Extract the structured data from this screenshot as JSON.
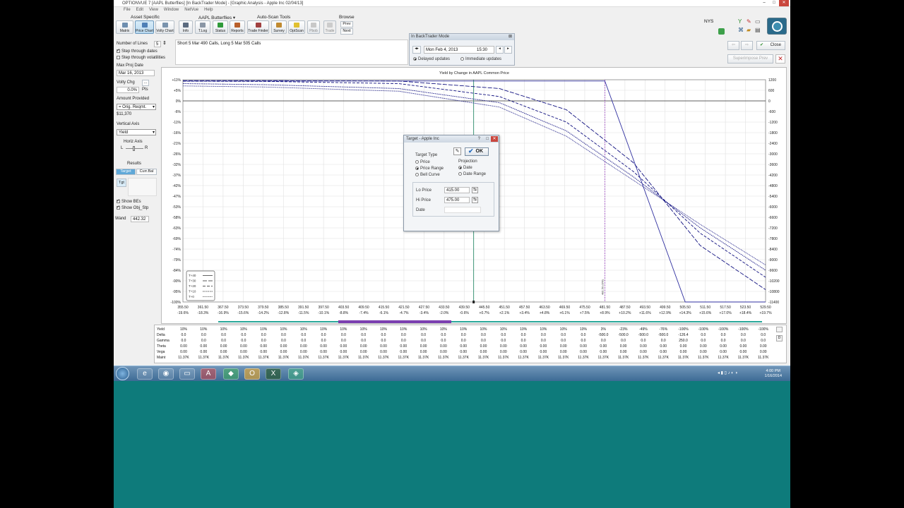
{
  "window": {
    "title": "OPTIONVUE 7   [AAPL Butterflies]   [In BackTrader Mode]  - [Graphic Analysis - Apple Inc  02/04/13]",
    "menu": [
      "File",
      "Edit",
      "View",
      "Window",
      "NetVue",
      "Help"
    ]
  },
  "toolbar": {
    "group_asset": "Asset Specific",
    "group_portfolio": "AAPL Butterflies ▾",
    "group_autoscan": "Auto-Scan Tools",
    "group_browse": "Browse",
    "buttons": [
      "Matrix",
      "Price Chart",
      "Volty Chart",
      "Info",
      "T.Log",
      "Status",
      "Reports",
      "Trade Finder",
      "Survey",
      "OptScan",
      "Pbob",
      "Trade"
    ],
    "prev": "Prev",
    "next": "Next",
    "nys": "NYS"
  },
  "left": {
    "num_lines_label": "Number of Lines",
    "num_lines_value": "5",
    "step_dates": "Step through dates",
    "step_vols": "Step through volatilities",
    "max_proj_label": "Max Proj Date",
    "max_proj_value": "Mar 16, 2013",
    "volty_label": "Volty Chg",
    "volty_value": "0.0%",
    "volty_unit": "Pts",
    "amount_label": "Amount Provided",
    "amount_select": "= Orig. Reqmt.",
    "amount_value": "$11,370",
    "vaxis_label": "Vertical Axis",
    "vaxis_value": "Yield",
    "haxis_label": "Horiz Axis",
    "haxis_l": "L",
    "haxis_r": "R",
    "results_label": "Results",
    "target_btn": "Target",
    "currbal_btn": "Curr.Bal",
    "tgt_btn": "Tgt",
    "show_bes": "Show BEs",
    "show_objstp": "Show Obj_Stp",
    "wand_label": "Wand",
    "wand_value": "442.32"
  },
  "strategy": "Short 5 Mar 490 Calls, Long 5 Mar 505 Calls",
  "backtrader": {
    "title": "In BackTrader Mode",
    "date": "Mon Feb 4, 2013",
    "time": "15:30",
    "delayed": "Delayed updates",
    "immediate": "Immediate updates"
  },
  "right": {
    "close": "Close",
    "superimpose": "Superimpose Prev"
  },
  "chart_data": {
    "type": "line",
    "title": "Yield by Change in AAPL Common Price",
    "x_ticks": [
      "355.50",
      "361.50",
      "367.50",
      "373.50",
      "379.50",
      "385.50",
      "391.50",
      "397.50",
      "403.50",
      "409.50",
      "415.50",
      "421.50",
      "427.50",
      "433.50",
      "439.50",
      "445.50",
      "451.50",
      "457.50",
      "463.50",
      "469.50",
      "475.50",
      "481.50",
      "487.50",
      "493.50",
      "499.50",
      "505.50",
      "511.50",
      "517.50",
      "523.50",
      "529.50"
    ],
    "x_pct": [
      "-19.6%",
      "-18.3%",
      "-16.9%",
      "-15.6%",
      "-14.2%",
      "-12.8%",
      "-11.5%",
      "-10.1%",
      "-8.8%",
      "-7.4%",
      "-6.1%",
      "-4.7%",
      "-3.4%",
      "-2.0%",
      "-0.6%",
      "+0.7%",
      "+2.1%",
      "+3.4%",
      "+4.8%",
      "+6.1%",
      "+7.5%",
      "+8.9%",
      "+10.2%",
      "+11.6%",
      "+12.9%",
      "+14.3%",
      "+15.6%",
      "+17.0%",
      "+18.4%",
      "+19.7%"
    ],
    "y_left_ticks": [
      "+11%",
      "+5%",
      "0%",
      "-6%",
      "-11%",
      "-16%",
      "-21%",
      "-26%",
      "-32%",
      "-37%",
      "-42%",
      "-47%",
      "-53%",
      "-58%",
      "-63%",
      "-69%",
      "-74%",
      "-79%",
      "-84%",
      "-90%",
      "-95%",
      "-100%"
    ],
    "y_right_ticks": [
      "1200",
      "600",
      "0",
      "-600",
      "-1200",
      "-1800",
      "-2400",
      "-3000",
      "-3600",
      "-4200",
      "-4800",
      "-5400",
      "-6000",
      "-6600",
      "-7200",
      "-7800",
      "-8400",
      "-9000",
      "-9600",
      "-10200",
      "-10800",
      "-11400"
    ],
    "x_range": [
      355.5,
      529.5
    ],
    "y_range": [
      -11400,
      1200
    ],
    "current_price": 442.32,
    "expiry_marker": 481.5,
    "expiry_marker_label": "481.50 (0%)",
    "legend": [
      "T+40",
      "T+30",
      "T+20",
      "T+10",
      "T+0"
    ],
    "series": [
      {
        "name": "T+40",
        "x": [
          355.5,
          475.5,
          481.5,
          505.5,
          529.5
        ],
        "y": [
          1130,
          1130,
          1130,
          -11400,
          -11400
        ]
      },
      {
        "name": "T+30",
        "x": [
          355.5,
          380,
          420,
          450,
          470,
          490,
          510,
          529.5
        ],
        "y": [
          1150,
          1150,
          1130,
          700,
          -500,
          -3500,
          -8200,
          -10700
        ]
      },
      {
        "name": "T+20",
        "x": [
          355.5,
          380,
          420,
          450,
          470,
          490,
          510,
          529.5
        ],
        "y": [
          1120,
          1110,
          980,
          250,
          -1200,
          -4000,
          -7500,
          -10000
        ]
      },
      {
        "name": "T+10",
        "x": [
          355.5,
          380,
          420,
          450,
          470,
          490,
          510,
          529.5
        ],
        "y": [
          980,
          920,
          700,
          -100,
          -1700,
          -4300,
          -7200,
          -9600
        ]
      },
      {
        "name": "T+0",
        "x": [
          355.5,
          380,
          420,
          450,
          470,
          490,
          510,
          529.5
        ],
        "y": [
          850,
          790,
          550,
          -350,
          -2000,
          -4500,
          -7000,
          -9300
        ]
      }
    ]
  },
  "greeks": {
    "rows": [
      "Yield",
      "Delta",
      "Gamma",
      "Theta",
      "Vega",
      "Maint"
    ],
    "yield": [
      "10%",
      "10%",
      "10%",
      "10%",
      "10%",
      "10%",
      "10%",
      "10%",
      "10%",
      "10%",
      "10%",
      "10%",
      "10%",
      "10%",
      "10%",
      "10%",
      "10%",
      "10%",
      "10%",
      "10%",
      "10%",
      "3%",
      "-23%",
      "-49%",
      "-76%",
      "-100%",
      "-100%",
      "-100%",
      "-100%",
      "-100%"
    ],
    "delta": [
      "0.0",
      "0.0",
      "0.0",
      "0.0",
      "0.0",
      "0.0",
      "0.0",
      "0.0",
      "0.0",
      "0.0",
      "0.0",
      "0.0",
      "0.0",
      "0.0",
      "0.0",
      "0.0",
      "0.0",
      "0.0",
      "0.0",
      "0.0",
      "0.0",
      "-500.0",
      "-500.0",
      "-500.0",
      "-500.0",
      "-126.4",
      "0.0",
      "0.0",
      "0.0",
      "0.0"
    ],
    "gamma": [
      "0.0",
      "0.0",
      "0.0",
      "0.0",
      "0.0",
      "0.0",
      "0.0",
      "0.0",
      "0.0",
      "0.0",
      "0.0",
      "0.0",
      "0.0",
      "0.0",
      "0.0",
      "0.0",
      "0.0",
      "0.0",
      "0.0",
      "0.0",
      "0.0",
      "0.0",
      "0.0",
      "0.0",
      "0.0",
      "250.0",
      "0.0",
      "0.0",
      "0.0",
      "0.0"
    ],
    "theta": [
      "0.00",
      "0.00",
      "0.00",
      "0.00",
      "0.00",
      "0.00",
      "0.00",
      "0.00",
      "0.00",
      "0.00",
      "0.00",
      "0.00",
      "0.00",
      "0.00",
      "0.00",
      "0.00",
      "0.00",
      "0.00",
      "0.00",
      "0.00",
      "0.00",
      "0.00",
      "0.00",
      "0.00",
      "0.00",
      "0.00",
      "0.00",
      "0.00",
      "0.00",
      "0.00"
    ],
    "vega": [
      "0.00",
      "0.00",
      "0.00",
      "0.00",
      "0.00",
      "0.00",
      "0.00",
      "0.00",
      "0.00",
      "0.00",
      "0.00",
      "0.00",
      "0.00",
      "0.00",
      "0.00",
      "0.00",
      "0.00",
      "0.00",
      "0.00",
      "0.00",
      "0.00",
      "0.00",
      "0.00",
      "0.00",
      "0.00",
      "0.00",
      "0.00",
      "0.00",
      "0.00",
      "0.00"
    ],
    "maint": [
      "11.37K",
      "11.37K",
      "11.37K",
      "11.37K",
      "11.37K",
      "11.37K",
      "11.37K",
      "11.37K",
      "11.37K",
      "11.37K",
      "11.37K",
      "11.37K",
      "11.37K",
      "11.37K",
      "11.37K",
      "11.37K",
      "11.37K",
      "11.37K",
      "11.37K",
      "11.37K",
      "11.37K",
      "11.37K",
      "11.37K",
      "11.37K",
      "11.37K",
      "11.37K",
      "11.37K",
      "11.37K",
      "11.37K",
      "11.37K"
    ]
  },
  "dialog": {
    "title": "Target - Apple Inc",
    "target_type": "Target Type",
    "price": "Price",
    "price_range": "Price Range",
    "bell_curve": "Bell Curve",
    "projection": "Projection",
    "date": "Date",
    "date_range": "Date Range",
    "ok": "OK",
    "lo_label": "Lo Price",
    "lo_value": "415.00",
    "hi_label": "Hi Price",
    "hi_value": "475.00",
    "date_label": "Date"
  },
  "taskbar": {
    "time": "4:00 PM",
    "date": "1/16/2014"
  },
  "colors": {
    "desktop": "#0e7b7b",
    "series": "#101080",
    "expiry": "#3030a0",
    "marker": "#9a40c0",
    "wand": "#2a8a6a"
  }
}
